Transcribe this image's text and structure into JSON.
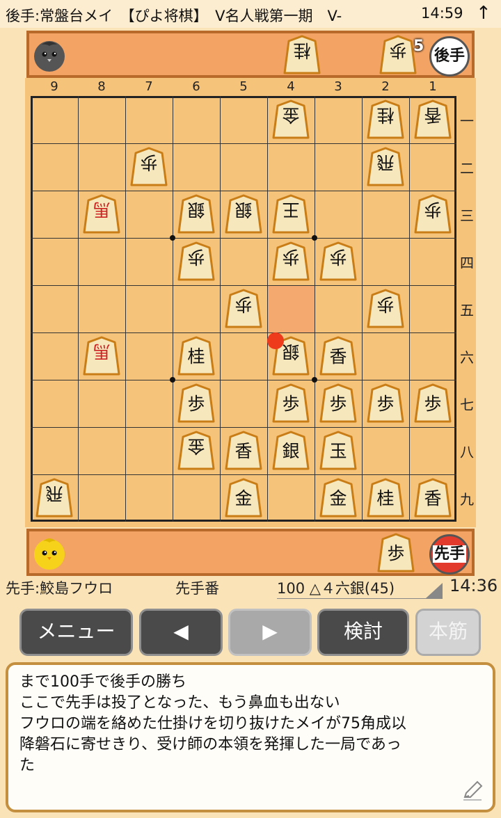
{
  "status_bar": {
    "title": "後手:常盤台メイ　【ぴよ将棋】　V名人戦第一期　V-",
    "time": "14:59",
    "arrow": "↑"
  },
  "gote": {
    "badge": "後手",
    "hand": [
      {
        "kind": "桂"
      },
      {
        "kind": "歩",
        "count": "5"
      }
    ]
  },
  "sente": {
    "badge": "先手",
    "hand": [
      {
        "kind": "歩"
      }
    ]
  },
  "file_labels": [
    "9",
    "8",
    "7",
    "6",
    "5",
    "4",
    "3",
    "2",
    "1"
  ],
  "rank_labels": [
    "一",
    "二",
    "三",
    "四",
    "五",
    "六",
    "七",
    "八",
    "九"
  ],
  "board": [
    {
      "file": 4,
      "rank": 1,
      "kind": "金",
      "side": "gote"
    },
    {
      "file": 2,
      "rank": 1,
      "kind": "桂",
      "side": "gote"
    },
    {
      "file": 1,
      "rank": 1,
      "kind": "香",
      "side": "gote"
    },
    {
      "file": 7,
      "rank": 2,
      "kind": "歩",
      "side": "gote"
    },
    {
      "file": 2,
      "rank": 2,
      "kind": "飛",
      "side": "gote"
    },
    {
      "file": 8,
      "rank": 3,
      "kind": "馬",
      "side": "gote",
      "promoted": true
    },
    {
      "file": 6,
      "rank": 3,
      "kind": "銀",
      "side": "gote"
    },
    {
      "file": 5,
      "rank": 3,
      "kind": "銀",
      "side": "gote"
    },
    {
      "file": 4,
      "rank": 3,
      "kind": "王",
      "side": "gote"
    },
    {
      "file": 1,
      "rank": 3,
      "kind": "歩",
      "side": "gote"
    },
    {
      "file": 6,
      "rank": 4,
      "kind": "歩",
      "side": "gote"
    },
    {
      "file": 4,
      "rank": 4,
      "kind": "歩",
      "side": "gote"
    },
    {
      "file": 3,
      "rank": 4,
      "kind": "歩",
      "side": "gote"
    },
    {
      "file": 5,
      "rank": 5,
      "kind": "歩",
      "side": "gote"
    },
    {
      "file": 2,
      "rank": 5,
      "kind": "歩",
      "side": "gote"
    },
    {
      "file": 8,
      "rank": 6,
      "kind": "馬",
      "side": "gote",
      "promoted": true
    },
    {
      "file": 6,
      "rank": 6,
      "kind": "桂",
      "side": "sente"
    },
    {
      "file": 4,
      "rank": 6,
      "kind": "銀",
      "side": "gote"
    },
    {
      "file": 3,
      "rank": 6,
      "kind": "香",
      "side": "sente"
    },
    {
      "file": 6,
      "rank": 7,
      "kind": "歩",
      "side": "sente"
    },
    {
      "file": 4,
      "rank": 7,
      "kind": "歩",
      "side": "sente"
    },
    {
      "file": 3,
      "rank": 7,
      "kind": "歩",
      "side": "sente"
    },
    {
      "file": 2,
      "rank": 7,
      "kind": "歩",
      "side": "sente"
    },
    {
      "file": 1,
      "rank": 7,
      "kind": "歩",
      "side": "sente"
    },
    {
      "file": 6,
      "rank": 8,
      "kind": "金",
      "side": "gote"
    },
    {
      "file": 5,
      "rank": 8,
      "kind": "香",
      "side": "sente"
    },
    {
      "file": 4,
      "rank": 8,
      "kind": "銀",
      "side": "sente"
    },
    {
      "file": 3,
      "rank": 8,
      "kind": "玉",
      "side": "sente"
    },
    {
      "file": 9,
      "rank": 9,
      "kind": "飛",
      "side": "gote"
    },
    {
      "file": 5,
      "rank": 9,
      "kind": "金",
      "side": "sente"
    },
    {
      "file": 3,
      "rank": 9,
      "kind": "金",
      "side": "sente"
    },
    {
      "file": 2,
      "rank": 9,
      "kind": "桂",
      "side": "sente"
    },
    {
      "file": 1,
      "rank": 9,
      "kind": "香",
      "side": "sente"
    }
  ],
  "last_move_square": {
    "file": 4,
    "rank": 5
  },
  "colors": {
    "board": "#f6c37a",
    "stand": "#f3a465",
    "last_move": "#f4a66e",
    "marker": "#ee3b1b",
    "promoted_text": "#c22222"
  },
  "info": {
    "sente_player": "先手:鮫島フウロ",
    "turn": "先手番",
    "move": "100 △４六銀(45)",
    "clock": "14:36"
  },
  "buttons": {
    "menu": "メニュー",
    "prev": "◀",
    "next": "▶",
    "review": "検討",
    "mainline": "本筋"
  },
  "comment": [
    "まで100手で後手の勝ち",
    "ここで先手は投了となった、もう鼻血も出ない",
    "フウロの端を絡めた仕掛けを切り抜けたメイが75角成以",
    "降磐石に寄せきり、受け師の本領を発揮した一局であっ",
    "た"
  ]
}
